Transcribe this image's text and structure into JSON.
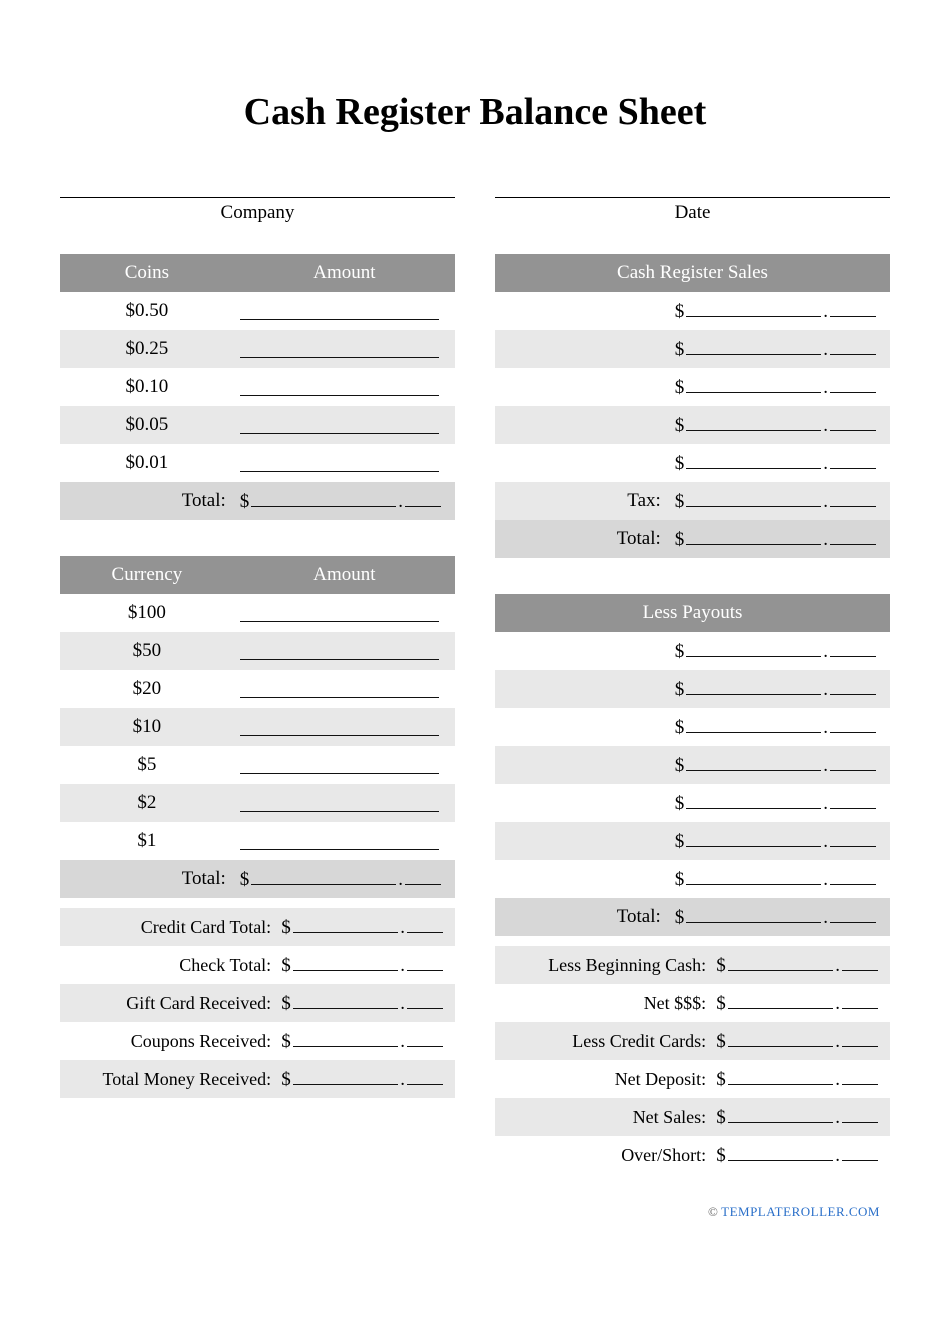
{
  "title": "Cash Register Balance Sheet",
  "top_fields": {
    "company": "Company",
    "date": "Date"
  },
  "coins": {
    "header_left": "Coins",
    "header_right": "Amount",
    "rows": [
      "$0.50",
      "$0.25",
      "$0.10",
      "$0.05",
      "$0.01"
    ],
    "total_label": "Total:"
  },
  "sales": {
    "header": "Cash Register Sales",
    "rows": 5,
    "tax_label": "Tax:",
    "total_label": "Total:"
  },
  "currency": {
    "header_left": "Currency",
    "header_right": "Amount",
    "rows": [
      "$100",
      "$50",
      "$20",
      "$10",
      "$5",
      "$2",
      "$1"
    ],
    "total_label": "Total:"
  },
  "payouts": {
    "header": "Less Payouts",
    "rows": 7,
    "total_label": "Total:"
  },
  "summary_left": [
    "Credit Card Total:",
    "Check Total:",
    "Gift Card Received:",
    "Coupons Received:",
    "Total Money Received:"
  ],
  "summary_right": [
    "Less Beginning Cash:",
    "Net $$$:",
    "Less Credit Cards:",
    "Net Deposit:",
    "Net Sales:",
    "Over/Short:"
  ],
  "footer": {
    "copy": "©",
    "link": "TEMPLATEROLLER.COM"
  }
}
